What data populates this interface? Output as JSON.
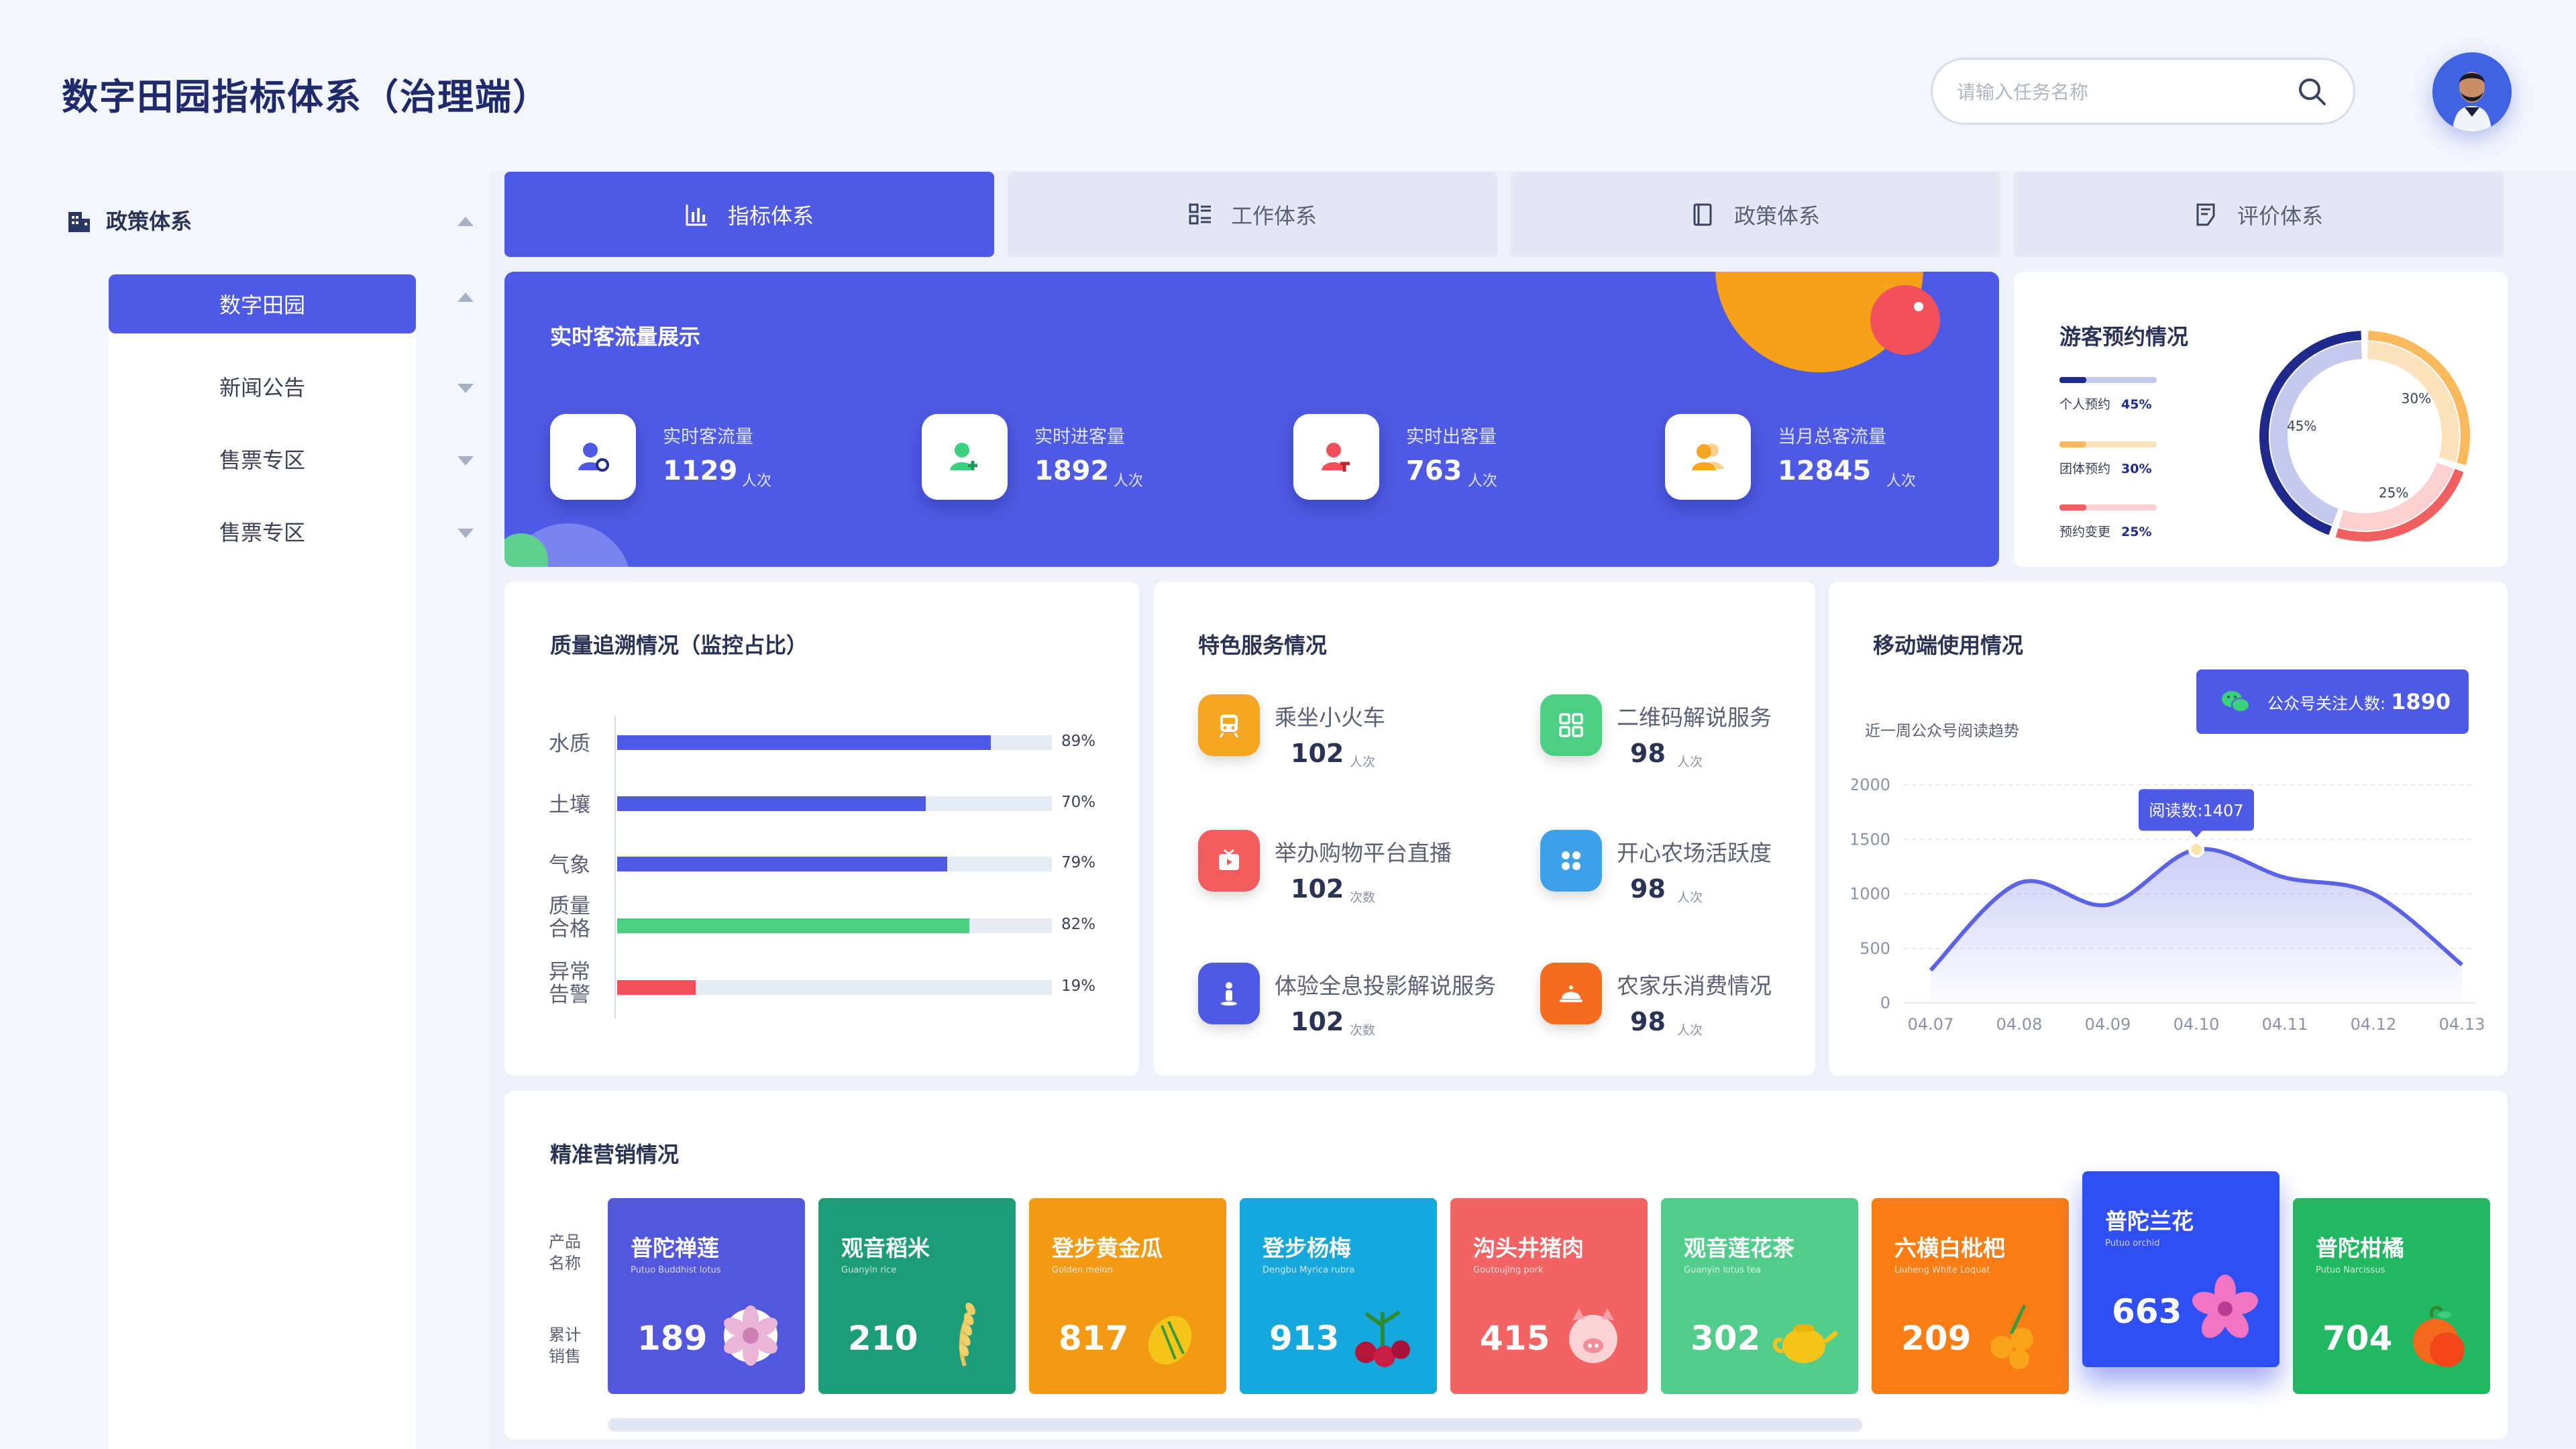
{
  "app_title": "数字田园指标体系（治理端）",
  "search": {
    "placeholder": "请输入任务名称"
  },
  "sidebar": {
    "section_label": "政策体系",
    "items": [
      {
        "label": "数字田园",
        "active": true
      },
      {
        "label": "新闻公告",
        "active": false
      },
      {
        "label": "售票专区",
        "active": false
      },
      {
        "label": "售票专区",
        "active": false
      }
    ]
  },
  "tabs": [
    {
      "label": "指标体系",
      "icon": "bar-chart-icon",
      "active": true
    },
    {
      "label": "工作体系",
      "icon": "list-icon",
      "active": false
    },
    {
      "label": "政策体系",
      "icon": "book-icon",
      "active": false
    },
    {
      "label": "评价体系",
      "icon": "edit-doc-icon",
      "active": false
    }
  ],
  "realtime": {
    "title": "实时客流量展示",
    "cards": [
      {
        "label": "实时客流量",
        "value": "1129",
        "unit": "人次",
        "icon": "user-search-icon",
        "color": "#4f5ae4"
      },
      {
        "label": "实时进客量",
        "value": "1892",
        "unit": "人次",
        "icon": "user-add-icon",
        "color": "#3ccf7e"
      },
      {
        "label": "实时出客量",
        "value": "763",
        "unit": "人次",
        "icon": "user-exit-icon",
        "color": "#f2505a"
      },
      {
        "label": "当月总客流量",
        "value": "12845",
        "unit": "人次",
        "icon": "users-icon",
        "color": "#f5a623"
      }
    ]
  },
  "reservation": {
    "title": "游客预约情况",
    "items": [
      {
        "label": "个人预约",
        "pct": "45%",
        "value": 45,
        "color": "#1f2a8c",
        "light": "#c5c9ee"
      },
      {
        "label": "团体预约",
        "pct": "30%",
        "value": 30,
        "color": "#f9b95c",
        "light": "#fde3bd"
      },
      {
        "label": "预约变更",
        "pct": "25%",
        "value": 25,
        "color": "#f06060",
        "light": "#fbd0d0"
      }
    ]
  },
  "quality": {
    "title": "质量追溯情况（监控占比）",
    "rows": [
      {
        "label": "水质",
        "pct": "89%",
        "value": 89,
        "color": "#4f5ae4"
      },
      {
        "label": "土壤",
        "pct": "70%",
        "value": 70,
        "color": "#4f5ae4"
      },
      {
        "label": "气象",
        "pct": "79%",
        "value": 79,
        "color": "#4f5ae4"
      },
      {
        "label_l1": "质量",
        "label_l2": "合格",
        "pct": "82%",
        "value": 82,
        "color": "#4ccf85"
      },
      {
        "label_l1": "异常",
        "label_l2": "告警",
        "pct": "19%",
        "value": 19,
        "color": "#f2505a"
      }
    ]
  },
  "services": {
    "title": "特色服务情况",
    "items": [
      {
        "name": "乘坐小火车",
        "value": "102",
        "unit": "人次",
        "icon": "train-icon",
        "color": "#f5a623"
      },
      {
        "name": "二维码解说服务",
        "value": "98",
        "unit": "人次",
        "icon": "qrcode-icon",
        "color": "#4ccf85"
      },
      {
        "name": "举办购物平台直播",
        "value": "102",
        "unit": "次数",
        "icon": "live-icon",
        "color": "#f25c5c"
      },
      {
        "name": "开心农场活跃度",
        "value": "98",
        "unit": "人次",
        "icon": "farm-icon",
        "color": "#3fa0ea"
      },
      {
        "name": "体验全息投影解说服务",
        "value": "102",
        "unit": "次数",
        "icon": "hologram-icon",
        "color": "#4f5ae4"
      },
      {
        "name": "农家乐消费情况",
        "value": "98",
        "unit": "人次",
        "icon": "dish-icon",
        "color": "#f56b1f"
      }
    ]
  },
  "mobile": {
    "title": "移动端使用情况",
    "subtitle": "近一周公众号阅读趋势",
    "badge_label": "公众号关注人数:",
    "badge_value": "1890",
    "tooltip": "阅读数:1407"
  },
  "chart_data": {
    "type": "area",
    "x": [
      "04.07",
      "04.08",
      "04.09",
      "04.10",
      "04.11",
      "04.12",
      "04.13"
    ],
    "series": [
      {
        "values": [
          300,
          1100,
          900,
          1407,
          1150,
          1000,
          350
        ]
      }
    ],
    "y_ticks": [
      "2000",
      "1500",
      "1000",
      "500",
      "0"
    ],
    "ylim": [
      0,
      2000
    ],
    "color": "#5a62e6",
    "grid": true,
    "highlight_index": 3
  },
  "marketing": {
    "title": "精准营销情况",
    "row_label_name_l1": "产品",
    "row_label_name_l2": "名称",
    "row_label_sales_l1": "累计",
    "row_label_sales_l2": "销售",
    "products": [
      {
        "name": "普陀禅莲",
        "en": "Putuo Buddhist lotus",
        "value": "189",
        "color": "#5257de",
        "icon": "lotus-icon"
      },
      {
        "name": "观音稻米",
        "en": "Guanyin rice",
        "value": "210",
        "color": "#1d9c78",
        "icon": "rice-icon"
      },
      {
        "name": "登步黄金瓜",
        "en": "Golden melon",
        "value": "817",
        "color": "#f29a13",
        "icon": "melon-icon"
      },
      {
        "name": "登步杨梅",
        "en": "Dengbu Myrica rubra",
        "value": "913",
        "color": "#16a8dc",
        "icon": "bayberry-icon"
      },
      {
        "name": "沟头井猪肉",
        "en": "Goutoujing pork",
        "value": "415",
        "color": "#f26464",
        "icon": "pig-icon"
      },
      {
        "name": "观音莲花茶",
        "en": "Guanyin lotus tea",
        "value": "302",
        "color": "#52cc8a",
        "icon": "teapot-icon"
      },
      {
        "name": "六横白枇杷",
        "en": "Liuheng White Loquat",
        "value": "209",
        "color": "#fa7d16",
        "icon": "loquat-icon"
      },
      {
        "name": "普陀兰花",
        "en": "Putuo orchid",
        "value": "663",
        "color": "#2f4ff2",
        "icon": "orchid-icon"
      },
      {
        "name": "普陀柑橘",
        "en": "Putuo Narcissus",
        "value": "704",
        "color": "#22b862",
        "icon": "orange-icon"
      }
    ]
  }
}
